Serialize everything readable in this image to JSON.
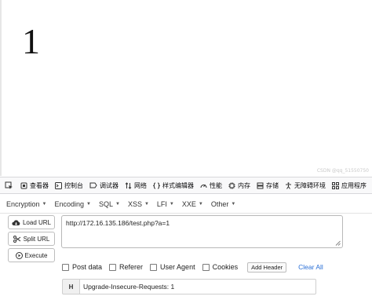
{
  "page": {
    "output_text": "1",
    "watermark": "CSDN @qq_51550750"
  },
  "devtools": {
    "tabs": [
      {
        "label": "查看器",
        "icon": "inspector-icon"
      },
      {
        "label": "控制台",
        "icon": "console-icon"
      },
      {
        "label": "调试器",
        "icon": "debugger-icon"
      },
      {
        "label": "网络",
        "icon": "network-icon"
      },
      {
        "label": "样式编辑器",
        "icon": "style-editor-icon"
      },
      {
        "label": "性能",
        "icon": "performance-icon"
      },
      {
        "label": "内存",
        "icon": "memory-icon"
      },
      {
        "label": "存储",
        "icon": "storage-icon"
      },
      {
        "label": "无障碍环境",
        "icon": "accessibility-icon"
      },
      {
        "label": "应用程序",
        "icon": "application-icon"
      }
    ]
  },
  "hackbar": {
    "menus": [
      "Encryption",
      "Encoding",
      "SQL",
      "XSS",
      "LFI",
      "XXE",
      "Other"
    ],
    "load_url_label": "Load URL",
    "split_url_label": "Split URL",
    "execute_label": "Execute",
    "url_value": "http://172.16.135.186/test.php?a=1",
    "options": {
      "post_data": "Post data",
      "referer": "Referer",
      "user_agent": "User Agent",
      "cookies": "Cookies"
    },
    "add_header_label": "Add Header",
    "clear_all_label": "Clear All",
    "header_badge": "H",
    "header_value": "Upgrade-Insecure-Requests: 1"
  }
}
